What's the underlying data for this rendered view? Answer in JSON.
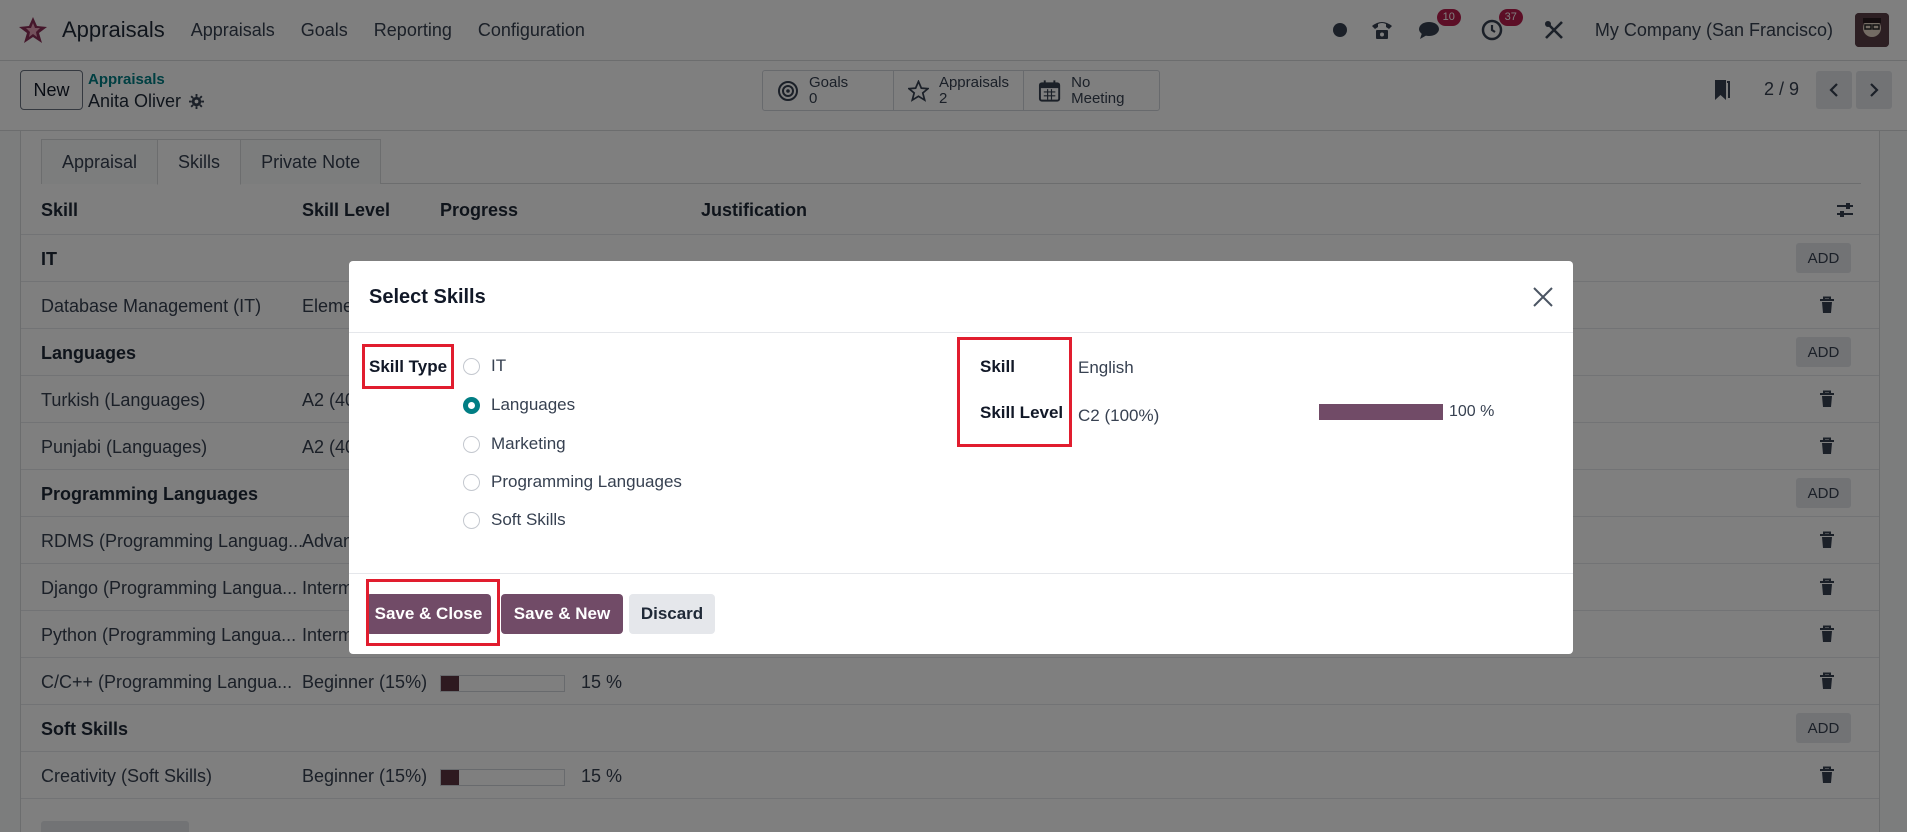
{
  "navbar": {
    "app_name": "Appraisals",
    "menu": [
      "Appraisals",
      "Goals",
      "Reporting",
      "Configuration"
    ],
    "messages_count": "10",
    "activities_count": "37",
    "company": "My Company (San Francisco)"
  },
  "control": {
    "new_label": "New",
    "breadcrumb_parent": "Appraisals",
    "breadcrumb_current": "Anita Oliver",
    "smart": {
      "goals_label": "Goals",
      "goals_count": "0",
      "appraisals_label": "Appraisals",
      "appraisals_count": "2",
      "meeting_label": "No Meeting"
    },
    "pager": "2 / 9"
  },
  "tabs": [
    "Appraisal",
    "Skills",
    "Private Note"
  ],
  "list": {
    "headers": {
      "skill": "Skill",
      "level": "Skill Level",
      "progress": "Progress",
      "justification": "Justification"
    },
    "add_label": "ADD",
    "rows": [
      {
        "type": "group",
        "name": "IT"
      },
      {
        "type": "item",
        "name": "Database Management (IT)",
        "level": "Eleme"
      },
      {
        "type": "group",
        "name": "Languages"
      },
      {
        "type": "item",
        "name": "Turkish (Languages)",
        "level": "A2 (40"
      },
      {
        "type": "item",
        "name": "Punjabi (Languages)",
        "level": "A2 (40"
      },
      {
        "type": "group",
        "name": "Programming Languages"
      },
      {
        "type": "item",
        "name": "RDMS (Programming Languag...",
        "level": "Advan"
      },
      {
        "type": "item",
        "name": "Django (Programming Langua...",
        "level": "Interm"
      },
      {
        "type": "item",
        "name": "Python (Programming Langua...",
        "level": "Interm"
      },
      {
        "type": "item",
        "name": "C/C++ (Programming Langua...",
        "level": "Beginner (15%)",
        "progress": 15,
        "progress_text": "15 %"
      },
      {
        "type": "group",
        "name": "Soft Skills"
      },
      {
        "type": "item",
        "name": "Creativity (Soft Skills)",
        "level": "Beginner (15%)",
        "progress": 15,
        "progress_text": "15 %"
      }
    ]
  },
  "modal": {
    "title": "Select Skills",
    "skill_type_label": "Skill Type",
    "skill_types": [
      "IT",
      "Languages",
      "Marketing",
      "Programming Languages",
      "Soft Skills"
    ],
    "selected_type_index": 1,
    "skill_label": "Skill",
    "skill_value": "English",
    "skill_level_label": "Skill Level",
    "skill_level_value": "C2 (100%)",
    "level_progress": 100,
    "level_progress_text": "100 %",
    "buttons": {
      "save_close": "Save & Close",
      "save_new": "Save & New",
      "discard": "Discard"
    }
  },
  "colors": {
    "primary": "#714b67",
    "teal": "#017e84",
    "highlight": "#e11d2e"
  }
}
